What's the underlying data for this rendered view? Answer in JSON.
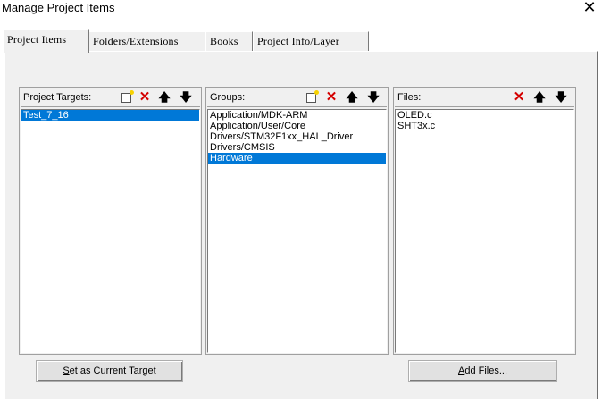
{
  "window": {
    "title": "Manage Project Items",
    "close": "✕"
  },
  "tabs": [
    {
      "label": "Project Items",
      "active": true
    },
    {
      "label": "Folders/Extensions",
      "active": false
    },
    {
      "label": "Books",
      "active": false
    },
    {
      "label": "Project Info/Layer",
      "active": false
    }
  ],
  "targets": {
    "label": "Project Targets:",
    "items": [
      "Test_7_16"
    ],
    "selected": "Test_7_16"
  },
  "groups": {
    "label": "Groups:",
    "items": [
      "Application/MDK-ARM",
      "Application/User/Core",
      "Drivers/STM32F1xx_HAL_Driver",
      "Drivers/CMSIS",
      "Hardware"
    ],
    "selected": "Hardware"
  },
  "files": {
    "label": "Files:",
    "items": [
      "OLED.c",
      "SHT3x.c"
    ]
  },
  "icons": {
    "new": "new-icon",
    "delete": "✕",
    "up": "🡅",
    "down": "🡇"
  },
  "buttons": {
    "set_target_underlined": "S",
    "set_target_rest": "et as Current Target",
    "add_files_underlined": "A",
    "add_files_rest": "dd Files..."
  },
  "colors": {
    "selection": "#0078d7",
    "delete": "#d40000",
    "panel": "#f0f0f0"
  }
}
